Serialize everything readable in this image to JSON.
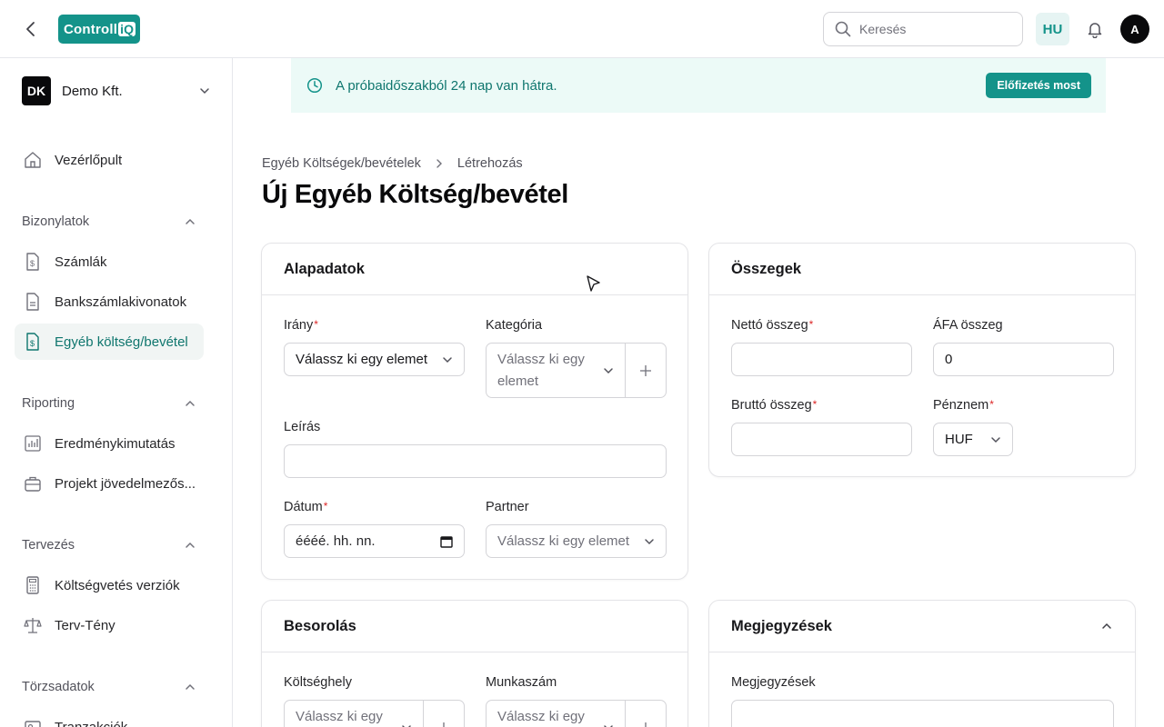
{
  "header": {
    "logo_text": "Controll",
    "logo_accent": "iQ",
    "search_placeholder": "Keresés",
    "language": "HU",
    "avatar_initial": "A",
    "brand_color": "#14938a"
  },
  "sidebar": {
    "company": {
      "initials": "DK",
      "name": "Demo Kft."
    },
    "dashboard": "Vezérlőpult",
    "sections": [
      {
        "label": "Bizonylatok",
        "items": [
          "Számlák",
          "Bankszámlakivonatok",
          "Egyéb költség/bevétel"
        ]
      },
      {
        "label": "Riporting",
        "items": [
          "Eredménykimutatás",
          "Projekt jövedelmezős..."
        ]
      },
      {
        "label": "Tervezés",
        "items": [
          "Költségvetés verziók",
          "Terv-Tény"
        ]
      },
      {
        "label": "Törzsadatok",
        "items": [
          "Tranzakciók"
        ]
      }
    ],
    "active_item": "Egyéb költség/bevétel"
  },
  "banner": {
    "text": "A próbaidőszakból 24 nap van hátra.",
    "cta": "Előfizetés most"
  },
  "breadcrumb": {
    "parent": "Egyéb Költségek/bevételek",
    "current": "Létrehozás"
  },
  "page_title": "Új Egyéb Költség/bevétel",
  "cards": {
    "alapadatok": {
      "title": "Alapadatok",
      "irany_label": "Irány",
      "irany_value": "Válassz ki egy elemet",
      "kategoria_label": "Kategória",
      "kategoria_placeholder": "Válassz ki egy elemet",
      "leiras_label": "Leírás",
      "leiras_value": "",
      "datum_label": "Dátum",
      "datum_placeholder": "éééé. hh. nn.",
      "partner_label": "Partner",
      "partner_placeholder": "Válassz ki egy elemet"
    },
    "osszegek": {
      "title": "Összegek",
      "netto_label": "Nettó összeg",
      "netto_value": "",
      "afa_label": "ÁFA összeg",
      "afa_value": "0",
      "brutto_label": "Bruttó összeg",
      "brutto_value": "",
      "penznem_label": "Pénznem",
      "penznem_value": "HUF"
    },
    "besorolas": {
      "title": "Besorolás",
      "koltseghely_label": "Költséghely",
      "koltseghely_placeholder": "Válassz ki egy elemet",
      "munkaszam_label": "Munkaszám",
      "munkaszam_placeholder": "Válassz ki egy elemet"
    },
    "megjegyzesek": {
      "title": "Megjegyzések",
      "field_label": "Megjegyzések",
      "field_value": ""
    }
  }
}
